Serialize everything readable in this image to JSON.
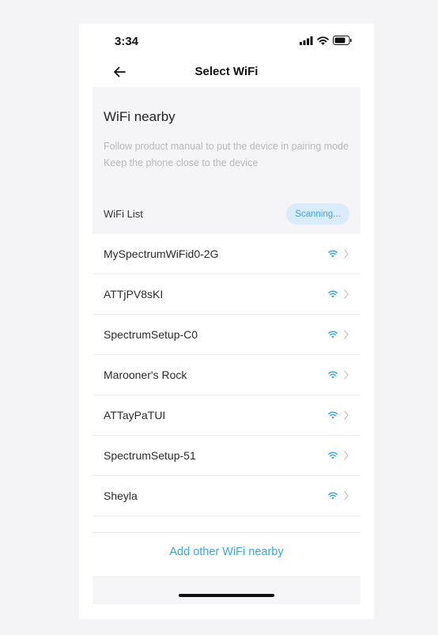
{
  "status_bar": {
    "time": "3:34"
  },
  "nav": {
    "title": "Select WiFi"
  },
  "info": {
    "title": "WiFi nearby",
    "instruction_1": "Follow product manual to put the device in pairing mode",
    "instruction_2": "Keep the phone close to the device",
    "list_label": "WiFi List",
    "scanning_label": "Scanning..."
  },
  "networks": [
    {
      "name": "MySpectrumWiFid0-2G"
    },
    {
      "name": "ATTjPV8sKI"
    },
    {
      "name": "SpectrumSetup-C0"
    },
    {
      "name": "Marooner's Rock"
    },
    {
      "name": "ATTayPaTUI"
    },
    {
      "name": "SpectrumSetup-51"
    },
    {
      "name": "Sheyla"
    }
  ],
  "footer": {
    "add_label": "Add other WiFi nearby"
  },
  "colors": {
    "accent": "#3aa5e6",
    "badge_bg": "#d9ecfb",
    "panel_bg": "#f5f5f7"
  },
  "icons": [
    "cellular-signal-icon",
    "wifi-status-icon",
    "battery-icon",
    "back-arrow-icon",
    "wifi-signal-icon",
    "chevron-right-icon"
  ]
}
